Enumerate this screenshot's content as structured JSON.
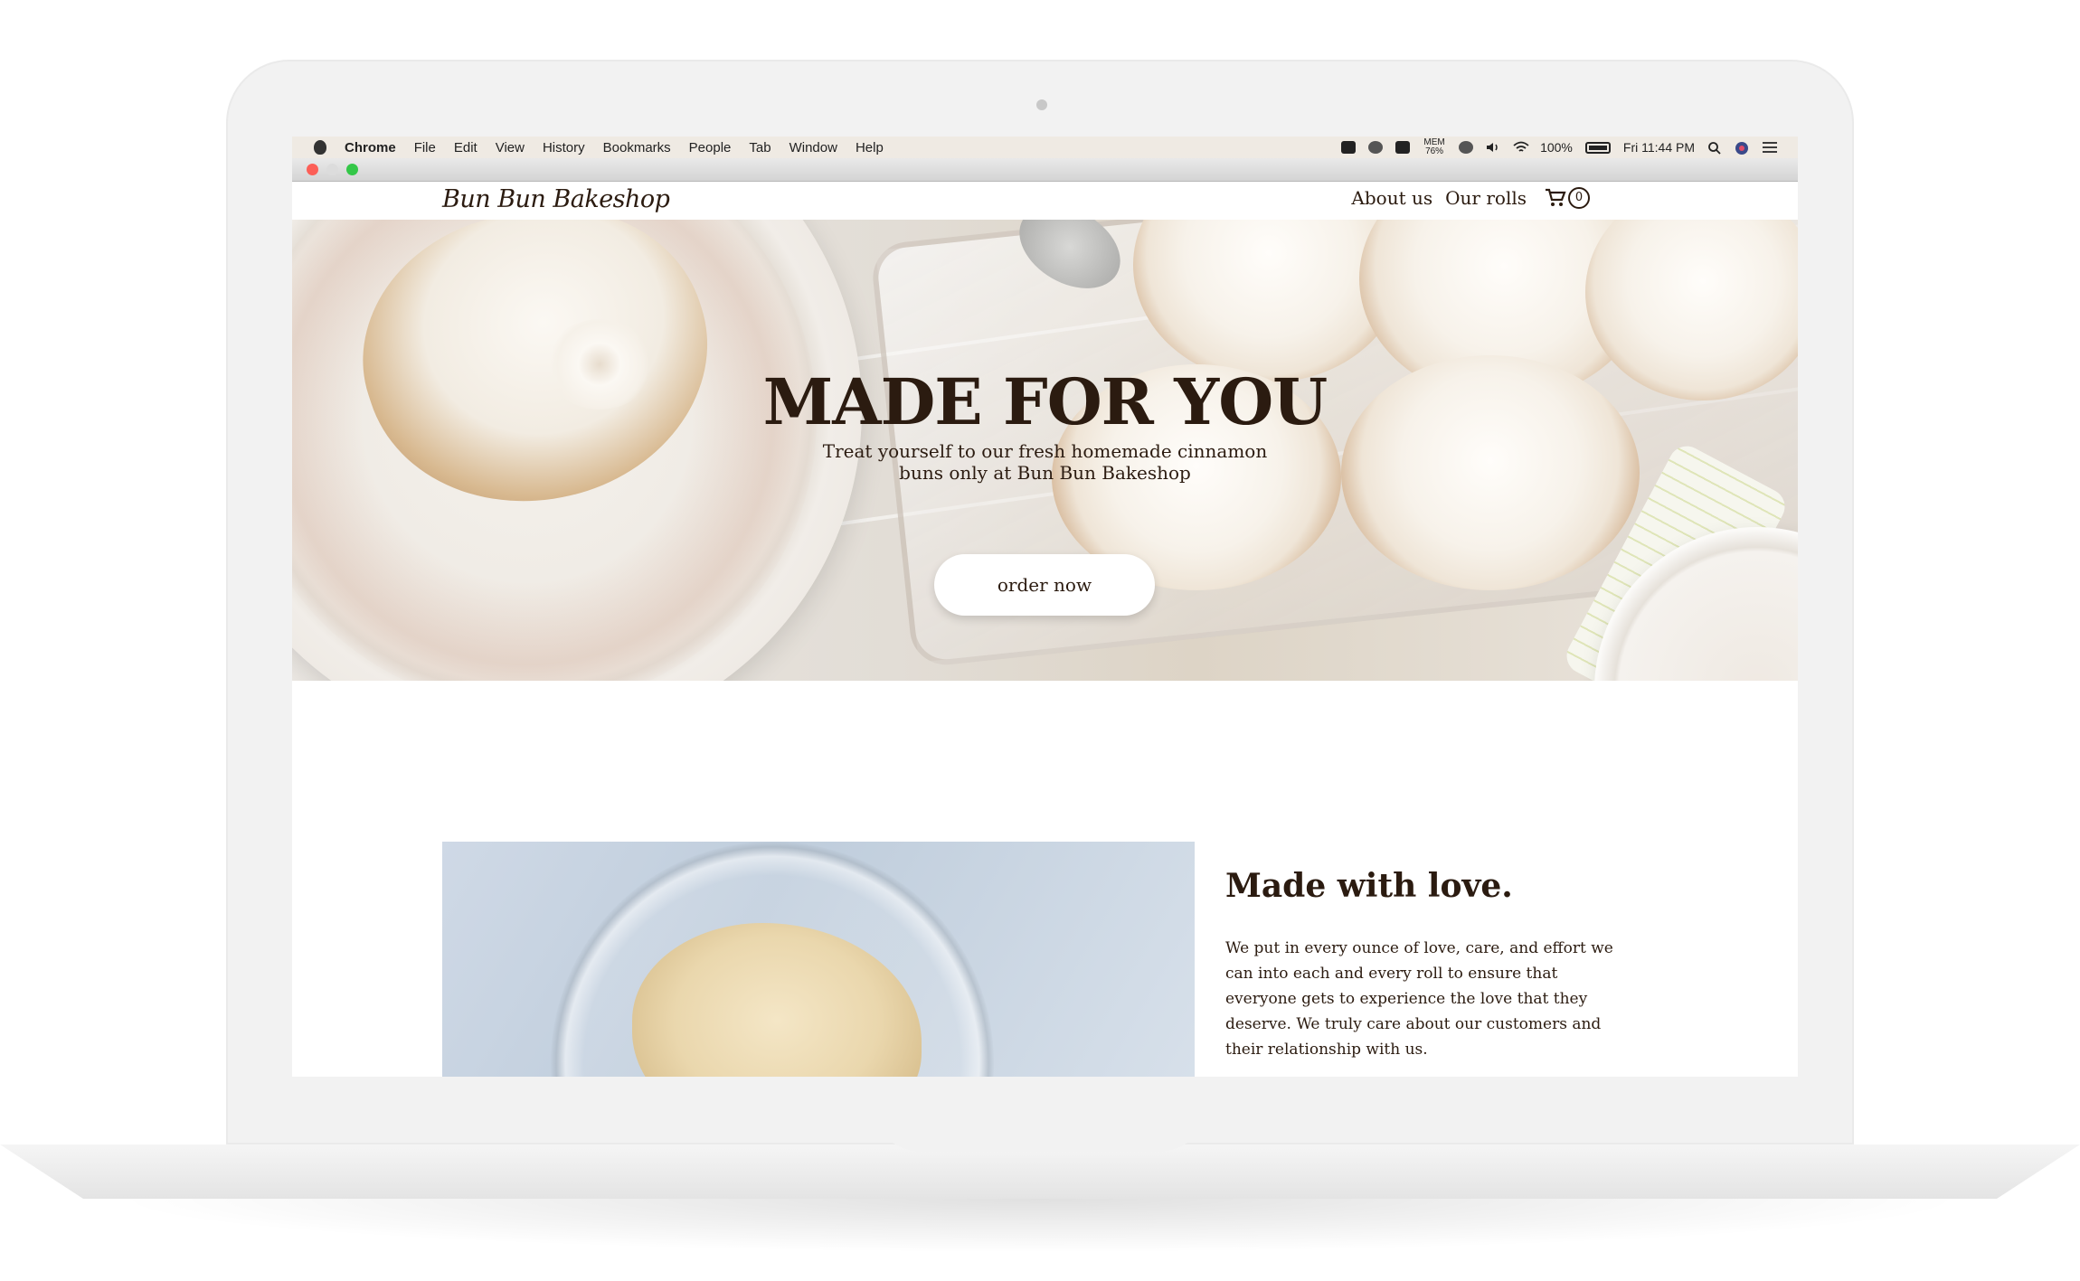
{
  "menubar": {
    "app_name": "Chrome",
    "menus": [
      "File",
      "Edit",
      "View",
      "History",
      "Bookmarks",
      "People",
      "Tab",
      "Window",
      "Help"
    ],
    "memory_label": "MEM",
    "memory_value": "76%",
    "battery_percent": "100%",
    "clock": "Fri 11:44 PM"
  },
  "site": {
    "logo": "Bun Bun Bakeshop",
    "nav": {
      "about": "About us",
      "rolls": "Our rolls",
      "cart_count": "0"
    },
    "hero": {
      "title": "MADE FOR YOU",
      "subtitle_line1": "Treat yourself to our fresh homemade cinnamon",
      "subtitle_line2": "buns only at Bun Bun Bakeshop",
      "cta": "order now"
    },
    "love": {
      "title": "Made with love.",
      "body": "We put in every ounce of love, care, and effort we can into each and every roll to ensure that everyone gets to experience the love that they deserve. We truly care about our customers and their relationship with us."
    }
  },
  "colors": {
    "text_brown": "#2b1b10",
    "menubar_bg": "#efeae3",
    "traffic_red": "#fc5f57",
    "traffic_green": "#34c748"
  }
}
